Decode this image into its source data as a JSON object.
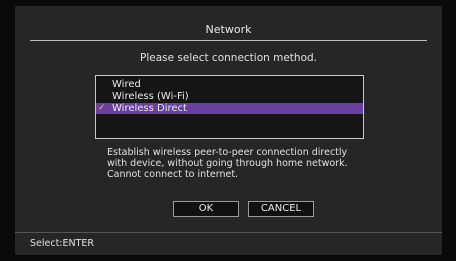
{
  "window": {
    "title": "Network"
  },
  "prompt": "Please select connection method.",
  "options": [
    {
      "label": "Wired",
      "selected": false
    },
    {
      "label": "Wireless (Wi-Fi)",
      "selected": false
    },
    {
      "label": "Wireless Direct",
      "selected": true
    }
  ],
  "check_glyph": "✓",
  "description": "Establish wireless peer-to-peer connection directly with device, without going through home network. Cannot connect to internet.",
  "buttons": {
    "ok": "OK",
    "cancel": "CANCEL"
  },
  "footer": {
    "hint": "Select:ENTER"
  },
  "colors": {
    "selection": "#6a3fa0",
    "check": "#f0c040",
    "background": "#262626"
  }
}
